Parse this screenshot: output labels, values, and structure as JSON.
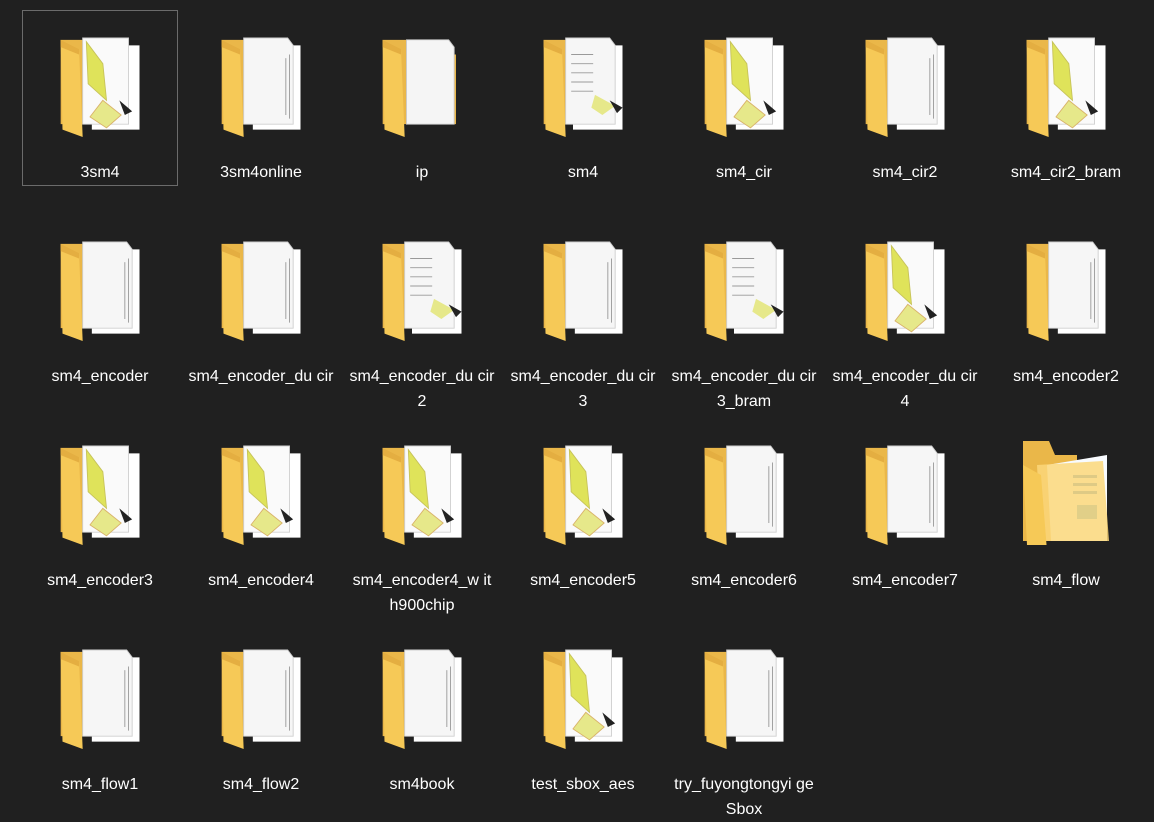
{
  "folders": [
    {
      "name": "3sm4",
      "type": "diagram",
      "selected": true
    },
    {
      "name": "3sm4online",
      "type": "doc"
    },
    {
      "name": "ip",
      "type": "blank"
    },
    {
      "name": "sm4",
      "type": "doc-arrow"
    },
    {
      "name": "sm4_cir",
      "type": "diagram"
    },
    {
      "name": "sm4_cir2",
      "type": "doc"
    },
    {
      "name": "sm4_cir2_bram",
      "type": "diagram"
    },
    {
      "name": "sm4_encoder",
      "type": "doc"
    },
    {
      "name": "sm4_encoder_du cir",
      "type": "doc"
    },
    {
      "name": "sm4_encoder_du cir2",
      "type": "doc-arrow"
    },
    {
      "name": "sm4_encoder_du cir3",
      "type": "doc"
    },
    {
      "name": "sm4_encoder_du cir3_bram",
      "type": "doc-arrow"
    },
    {
      "name": "sm4_encoder_du cir4",
      "type": "diagram"
    },
    {
      "name": "sm4_encoder2",
      "type": "doc"
    },
    {
      "name": "sm4_encoder3",
      "type": "diagram"
    },
    {
      "name": "sm4_encoder4",
      "type": "diagram"
    },
    {
      "name": "sm4_encoder4_w ith900chip",
      "type": "diagram"
    },
    {
      "name": "sm4_encoder5",
      "type": "diagram"
    },
    {
      "name": "sm4_encoder6",
      "type": "doc"
    },
    {
      "name": "sm4_encoder7",
      "type": "doc"
    },
    {
      "name": "sm4_flow",
      "type": "open"
    },
    {
      "name": "sm4_flow1",
      "type": "doc"
    },
    {
      "name": "sm4_flow2",
      "type": "doc"
    },
    {
      "name": "sm4book",
      "type": "doc"
    },
    {
      "name": "test_sbox_aes",
      "type": "diagram"
    },
    {
      "name": "try_fuyongtongyi geSbox",
      "type": "doc"
    }
  ],
  "colors": {
    "background": "#202020",
    "folder_back": "#f1c24f",
    "folder_front": "#fcd77a",
    "selection_border": "#6b6b6b",
    "text": "#ffffff"
  }
}
